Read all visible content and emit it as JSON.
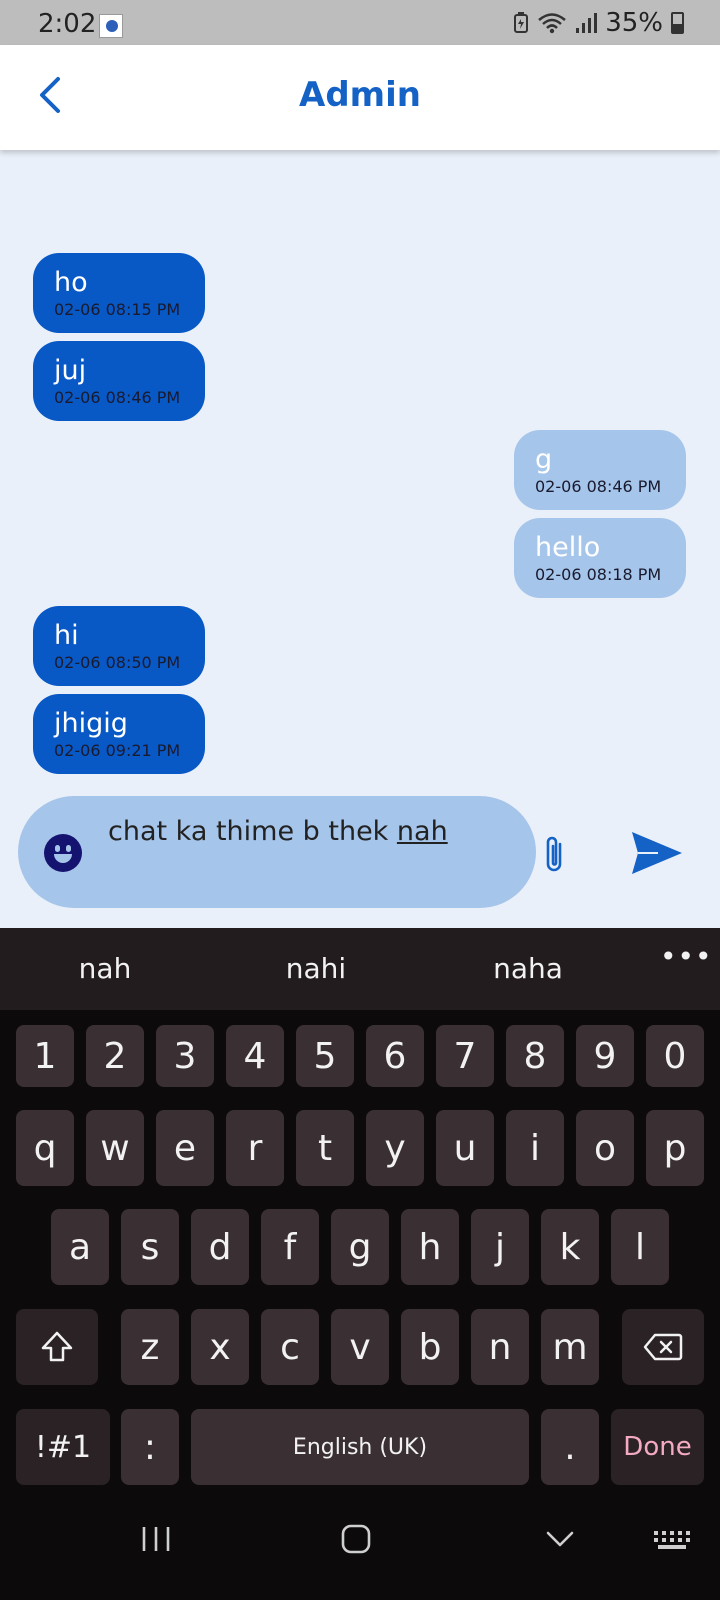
{
  "status_bar": {
    "time": "2:02",
    "battery": "35%",
    "icons": [
      "app-notification-icon",
      "battery-saver-icon",
      "wifi-icon",
      "signal-icon",
      "battery-icon"
    ]
  },
  "header": {
    "title": "Admin",
    "back_icon": "chevron-left-icon",
    "accent_color": "#1462c6"
  },
  "messages": [
    {
      "side": "received",
      "text": "ho",
      "time": "02-06 08:15 PM"
    },
    {
      "side": "received",
      "text": "juj",
      "time": "02-06 08:46 PM"
    },
    {
      "side": "sent",
      "text": "g",
      "time": "02-06 08:46 PM"
    },
    {
      "side": "sent",
      "text": "hello",
      "time": "02-06 08:18 PM"
    },
    {
      "side": "received",
      "text": "hi",
      "time": "02-06 08:50 PM"
    },
    {
      "side": "received",
      "text": "jhigig",
      "time": "02-06 09:21 PM"
    }
  ],
  "input": {
    "typed": "chat ka thime b thek ",
    "composing": "nah",
    "emoji_icon": "smiley-icon",
    "attach_icon": "paperclip-icon",
    "send_icon": "send-icon"
  },
  "colors": {
    "received_bubble": "#0858c5",
    "sent_bubble": "#a6c5ea",
    "chat_background": "#eaf0f9"
  },
  "keyboard": {
    "suggestions": [
      "nah",
      "nahi",
      "naha"
    ],
    "more": "•••",
    "number_row": [
      "1",
      "2",
      "3",
      "4",
      "5",
      "6",
      "7",
      "8",
      "9",
      "0"
    ],
    "row1": [
      "q",
      "w",
      "e",
      "r",
      "t",
      "y",
      "u",
      "i",
      "o",
      "p"
    ],
    "row2": [
      "a",
      "s",
      "d",
      "f",
      "g",
      "h",
      "j",
      "k",
      "l"
    ],
    "row3": [
      "z",
      "x",
      "c",
      "v",
      "b",
      "n",
      "m"
    ],
    "shift_icon": "shift-icon",
    "backspace_icon": "backspace-icon",
    "symbols": "!#1",
    "colon": ":",
    "space": "English (UK)",
    "period": ".",
    "done": "Done"
  },
  "nav_bar": {
    "recents_icon": "recents-icon",
    "home_icon": "home-icon",
    "back_icon": "nav-back-icon",
    "keyboard_icon": "keyboard-icon"
  }
}
